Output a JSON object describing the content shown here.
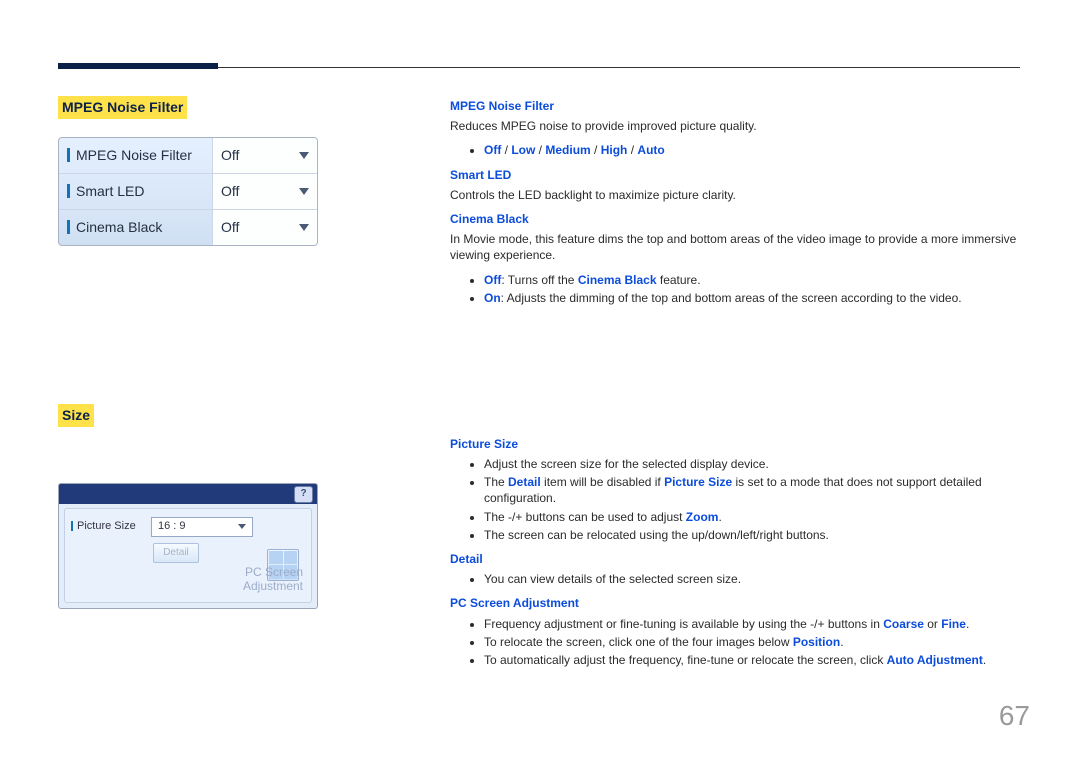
{
  "page_number": "67",
  "left": {
    "heading1": "MPEG Noise Filter",
    "osd1": {
      "rows": [
        {
          "label": "MPEG Noise Filter",
          "value": "Off"
        },
        {
          "label": "Smart LED",
          "value": "Off"
        },
        {
          "label": "Cinema Black",
          "value": "Off"
        }
      ]
    },
    "heading2": "Size",
    "osd2": {
      "help_icon": "?",
      "picture_size_label": "Picture Size",
      "picture_size_value": "16 : 9",
      "detail_button": "Detail",
      "pc_line1": "PC Screen",
      "pc_line2": "Adjustment"
    }
  },
  "right": {
    "mpeg": {
      "title": "MPEG Noise Filter",
      "desc": "Reduces MPEG noise to provide improved picture quality.",
      "opts": {
        "off": "Off",
        "low": "Low",
        "medium": "Medium",
        "high": "High",
        "auto": "Auto",
        "sep": " / "
      }
    },
    "smart": {
      "title": "Smart LED",
      "desc": "Controls the LED backlight to maximize picture clarity."
    },
    "cinema": {
      "title": "Cinema Black",
      "desc": "In Movie mode, this feature dims the top and bottom areas of the video image to provide a more immersive viewing experience.",
      "off_label": "Off",
      "off_text": ": Turns off the ",
      "off_feature": "Cinema Black",
      "off_tail": " feature.",
      "on_label": "On",
      "on_text": ": Adjusts the dimming of the top and bottom areas of the screen according to the video."
    },
    "size": {
      "title": "Picture Size",
      "b1": "Adjust the screen size for the selected display device.",
      "b2a": "The ",
      "b2_detail": "Detail",
      "b2b": " item will be disabled if ",
      "b2_ps": "Picture Size",
      "b2c": " is set to a mode that does not support detailed configuration.",
      "b3a": "The -/+ buttons can be used to adjust ",
      "b3_zoom": "Zoom",
      "b3b": ".",
      "b4": "The screen can be relocated using the up/down/left/right buttons.",
      "detail_title": "Detail",
      "d1": "You can view details of the selected screen size.",
      "pc_title": "PC Screen Adjustment",
      "p1a": "Frequency adjustment or fine-tuning is available by using the -/+ buttons in ",
      "p1_coarse": "Coarse",
      "p1_or": " or ",
      "p1_fine": "Fine",
      "p1b": ".",
      "p2a": "To relocate the screen, click one of the four images below ",
      "p2_pos": "Position",
      "p2b": ".",
      "p3a": "To automatically adjust the frequency, fine-tune or relocate the screen, click ",
      "p3_auto": "Auto Adjustment",
      "p3b": "."
    }
  }
}
